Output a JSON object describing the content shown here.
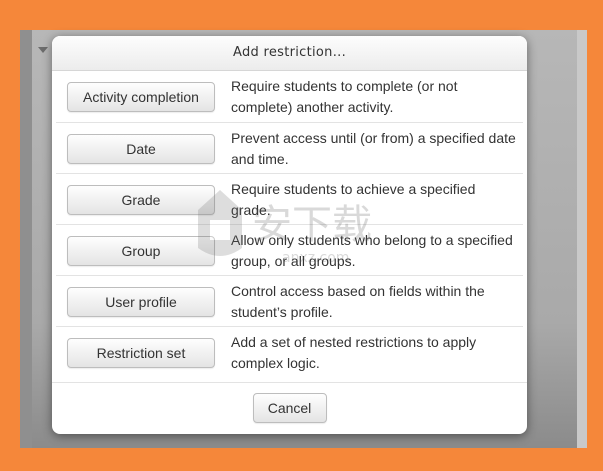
{
  "dialog": {
    "title": "Add restriction...",
    "restrictions": [
      {
        "label": "Activity completion",
        "description": "Require students to complete (or not complete) another activity."
      },
      {
        "label": "Date",
        "description": "Prevent access until (or from) a specified date and time."
      },
      {
        "label": "Grade",
        "description": "Require students to achieve a specified grade."
      },
      {
        "label": "Group",
        "description": "Allow only students who belong to a specified group, or all groups."
      },
      {
        "label": "User profile",
        "description": "Control access based on fields within the student’s profile."
      },
      {
        "label": "Restriction set",
        "description": "Add a set of nested restrictions to apply complex logic."
      }
    ],
    "cancel_label": "Cancel"
  },
  "watermark": {
    "text": "安下载",
    "subtext": "anxz.com"
  },
  "colors": {
    "frame": "#F5873A",
    "dialog_bg": "#FFFFFF",
    "button_border": "#BDBDBD",
    "text": "#333333"
  }
}
